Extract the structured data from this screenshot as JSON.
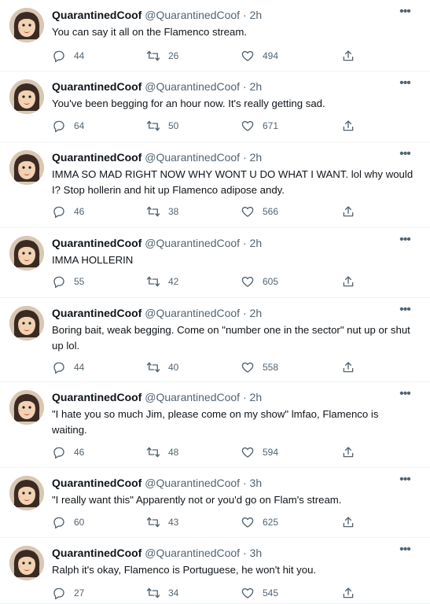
{
  "tweets": [
    {
      "name": "QuarantinedCoof",
      "handle": "@QuarantinedCoof",
      "dot": "·",
      "time": "2h",
      "text": "You can say it all on the Flamenco stream.",
      "replies": "44",
      "retweets": "26",
      "likes": "494"
    },
    {
      "name": "QuarantinedCoof",
      "handle": "@QuarantinedCoof",
      "dot": "·",
      "time": "2h",
      "text": "You've been begging for an hour now.  It's really getting sad.",
      "replies": "64",
      "retweets": "50",
      "likes": "671"
    },
    {
      "name": "QuarantinedCoof",
      "handle": "@QuarantinedCoof",
      "dot": "·",
      "time": "2h",
      "text": "IMMA SO MAD RIGHT NOW WHY WONT U DO WHAT I WANT.  lol why would I?  Stop hollerin and hit up Flamenco adipose andy.",
      "replies": "46",
      "retweets": "38",
      "likes": "566"
    },
    {
      "name": "QuarantinedCoof",
      "handle": "@QuarantinedCoof",
      "dot": "·",
      "time": "2h",
      "text": "IMMA HOLLERIN",
      "replies": "55",
      "retweets": "42",
      "likes": "605"
    },
    {
      "name": "QuarantinedCoof",
      "handle": "@QuarantinedCoof",
      "dot": "·",
      "time": "2h",
      "text": "Boring bait, weak begging.  Come on \"number one in the sector\" nut up or shut up lol.",
      "replies": "44",
      "retweets": "40",
      "likes": "558"
    },
    {
      "name": "QuarantinedCoof",
      "handle": "@QuarantinedCoof",
      "dot": "·",
      "time": "2h",
      "text": "\"I hate you so much Jim, please come on my show\" lmfao, Flamenco is waiting.",
      "replies": "46",
      "retweets": "48",
      "likes": "594"
    },
    {
      "name": "QuarantinedCoof",
      "handle": "@QuarantinedCoof",
      "dot": "·",
      "time": "3h",
      "text": "\"I really want this\"  Apparently not or you'd go on Flam's stream.",
      "replies": "60",
      "retweets": "43",
      "likes": "625"
    },
    {
      "name": "QuarantinedCoof",
      "handle": "@QuarantinedCoof",
      "dot": "·",
      "time": "3h",
      "text": "Ralph it's okay, Flamenco is Portuguese, he won't hit you.",
      "replies": "27",
      "retweets": "34",
      "likes": "545"
    }
  ],
  "colors": {
    "text": "#0f1419",
    "secondary": "#536471",
    "divider": "#eff3f4"
  },
  "icons": {
    "reply": "reply-icon",
    "retweet": "retweet-icon",
    "like": "heart-icon",
    "share": "share-icon",
    "more": "more-icon",
    "avatar": "avatar"
  }
}
